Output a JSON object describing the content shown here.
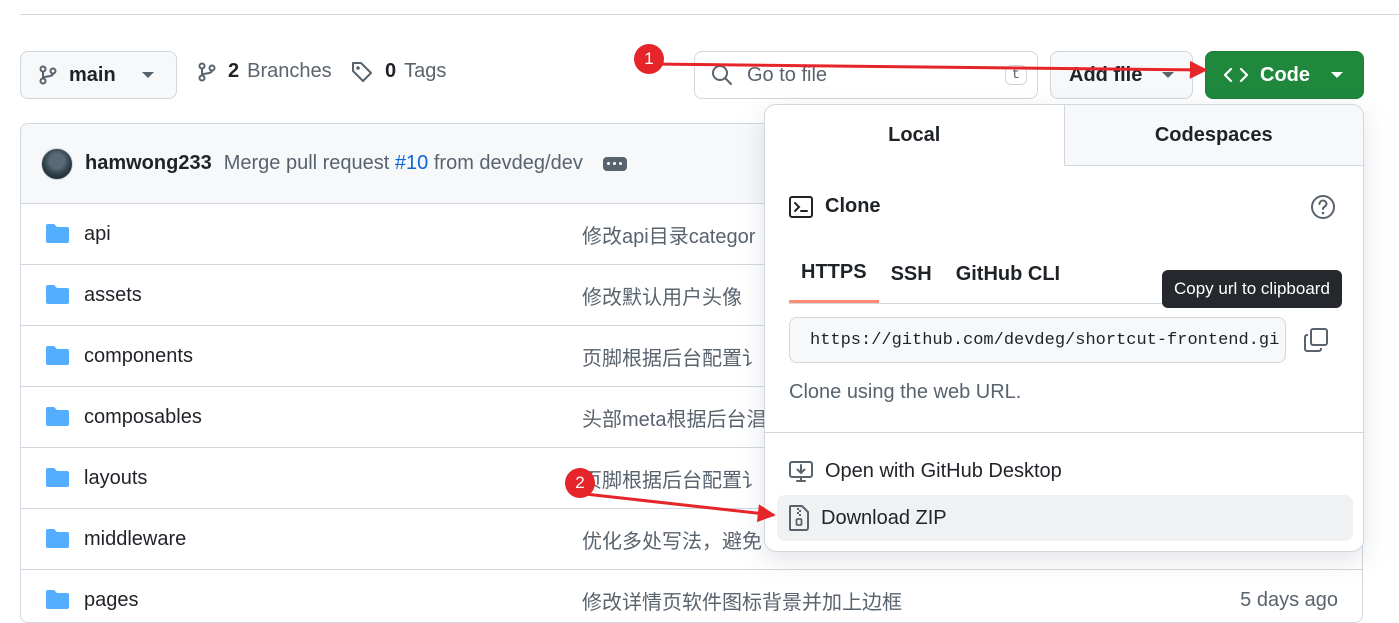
{
  "toolbar": {
    "branch_label": "main",
    "branches_count": "2",
    "branches_label": "Branches",
    "tags_count": "0",
    "tags_label": "Tags",
    "search_placeholder": "Go to file",
    "search_shortcut": "t",
    "add_file_label": "Add file",
    "code_label": "Code"
  },
  "commit": {
    "author": "hamwong233",
    "message_prefix": "Merge pull request",
    "pr_link": "#10",
    "message_suffix": "from devdeg/dev"
  },
  "files": [
    {
      "name": "api",
      "message": "修改api目录categor"
    },
    {
      "name": "assets",
      "message": "修改默认用户头像"
    },
    {
      "name": "components",
      "message": "页脚根据后台配置讠"
    },
    {
      "name": "composables",
      "message": "头部meta根据后台淐"
    },
    {
      "name": "layouts",
      "message": "页脚根据后台配置讠"
    },
    {
      "name": "middleware",
      "message": "优化多处写法，避免"
    },
    {
      "name": "pages",
      "message": "修改详情页软件图标背景并加上边框",
      "date": "5 days ago"
    }
  ],
  "code_dropdown": {
    "tabs": [
      "Local",
      "Codespaces"
    ],
    "clone_label": "Clone",
    "protocols": [
      "HTTPS",
      "SSH",
      "GitHub CLI"
    ],
    "clone_url": "https://github.com/devdeg/shortcut-frontend.git",
    "tooltip": "Copy url to clipboard",
    "clone_hint": "Clone using the web URL.",
    "open_desktop": "Open with GitHub Desktop",
    "download_zip": "Download ZIP"
  },
  "annotations": {
    "badge_1": "1",
    "badge_2": "2"
  },
  "colors": {
    "code_button": "#1f883d",
    "annotation": "#e5252a",
    "link": "#0969da",
    "tab_underline": "#fd8c73"
  }
}
